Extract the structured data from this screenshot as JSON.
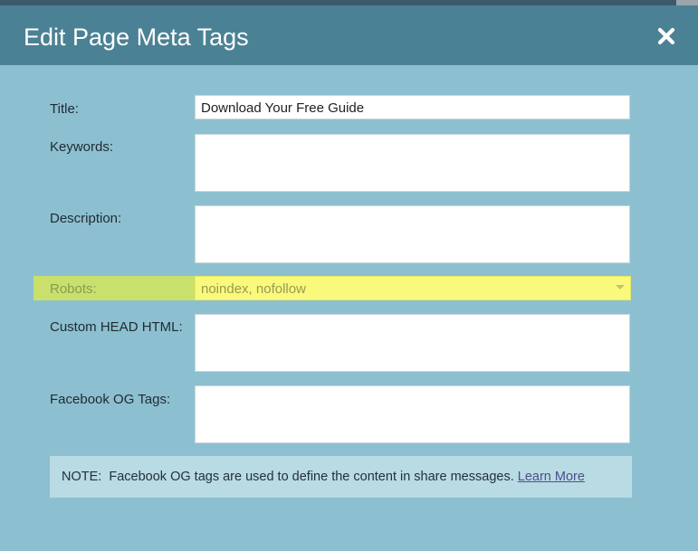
{
  "dialog": {
    "title": "Edit Page Meta Tags",
    "close_icon": "close-icon"
  },
  "form": {
    "title": {
      "label": "Title:",
      "value": "Download Your Free Guide"
    },
    "keywords": {
      "label": "Keywords:",
      "value": ""
    },
    "description": {
      "label": "Description:",
      "value": ""
    },
    "robots": {
      "label": "Robots:",
      "value": "noindex, nofollow"
    },
    "custom_head": {
      "label": "Custom HEAD HTML:",
      "value": ""
    },
    "facebook_og": {
      "label": "Facebook OG Tags:",
      "value": ""
    }
  },
  "note": {
    "prefix": "NOTE:",
    "text": "Facebook OG tags are used to define the content in share messages.",
    "link_label": "Learn More"
  },
  "colors": {
    "header": "#4b8194",
    "body": "#8cc0d0",
    "robots_highlight_label": "#c9e06d",
    "robots_highlight_field": "#f9f97c",
    "note_bg": "#b9dbe3"
  }
}
